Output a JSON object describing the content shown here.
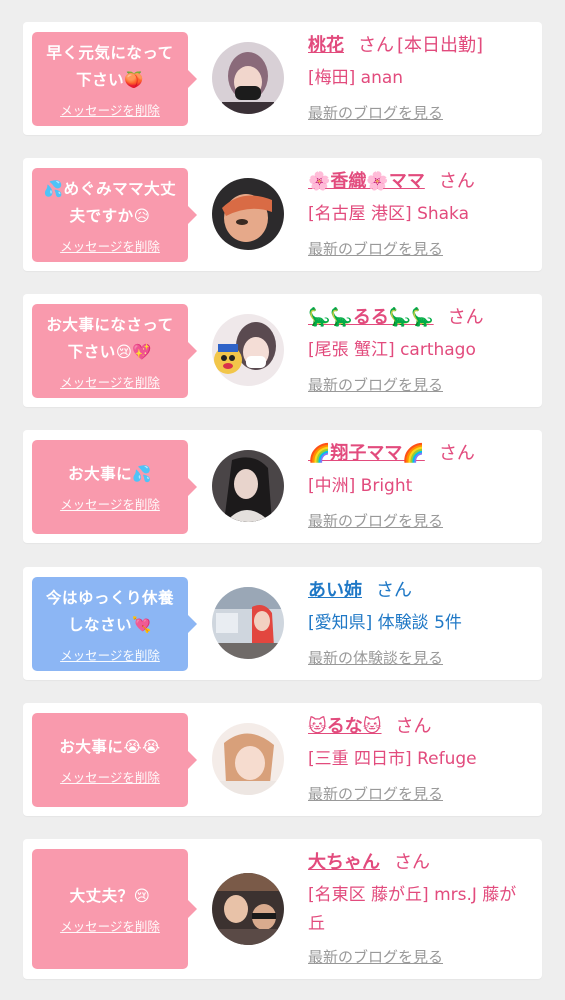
{
  "colors": {
    "pink_bubble": "#f99aad",
    "blue_bubble": "#8cb6f4",
    "pink_text": "#e24b7d",
    "blue_text": "#1f78c6",
    "link_gray": "#999999",
    "background": "#eeeeee"
  },
  "items": [
    {
      "message": "早く元気になって下さい🍑",
      "delete_label": "メッセージを削除",
      "bubble_color": "pink",
      "avatar": "person-photo",
      "name": "桃花",
      "honorific": "さん",
      "name_extra": "[本日出勤]",
      "shop": "[梅田] anan",
      "link": "最新のブログを見る"
    },
    {
      "message": "💦めぐみママ大丈夫ですか😥",
      "delete_label": "メッセージを削除",
      "bubble_color": "pink",
      "avatar": "person-photo",
      "name": "🌸香織🌸ママ",
      "honorific": "さん",
      "name_extra": "",
      "shop": "[名古屋 港区] Shaka",
      "link": "最新のブログを見る"
    },
    {
      "message": "お大事になさって下さい😢💖",
      "delete_label": "メッセージを削除",
      "bubble_color": "pink",
      "avatar": "person-photo",
      "name": "🦕🦕るる🦕🦕",
      "honorific": "さん",
      "name_extra": "",
      "shop": "[尾張 蟹江] carthago",
      "link": "最新のブログを見る"
    },
    {
      "message": "お大事に💦",
      "delete_label": "メッセージを削除",
      "bubble_color": "pink",
      "avatar": "person-photo",
      "name": "🌈翔子ママ🌈",
      "honorific": "さん",
      "name_extra": "",
      "shop": "[中洲] Bright",
      "link": "最新のブログを見る"
    },
    {
      "message": "今はゆっくり休養しなさい💘",
      "delete_label": "メッセージを削除",
      "bubble_color": "blue",
      "avatar": "person-photo",
      "name": "あい姉",
      "honorific": "さん",
      "name_extra": "",
      "shop": "[愛知県] 体験談 5件",
      "link": "最新の体験談を見る"
    },
    {
      "message": "お大事に😭😭",
      "delete_label": "メッセージを削除",
      "bubble_color": "pink",
      "avatar": "person-photo",
      "name": "🐱るな🐱",
      "honorific": "さん",
      "name_extra": "",
      "shop": "[三重 四日市] Refuge",
      "link": "最新のブログを見る"
    },
    {
      "message": "大丈夫？😢",
      "delete_label": "メッセージを削除",
      "bubble_color": "pink",
      "avatar": "person-photo",
      "name": "大ちゃん",
      "honorific": "さん",
      "name_extra": "",
      "shop": "[名東区 藤が丘] mrs.J 藤が丘",
      "link": "最新のブログを見る"
    }
  ]
}
